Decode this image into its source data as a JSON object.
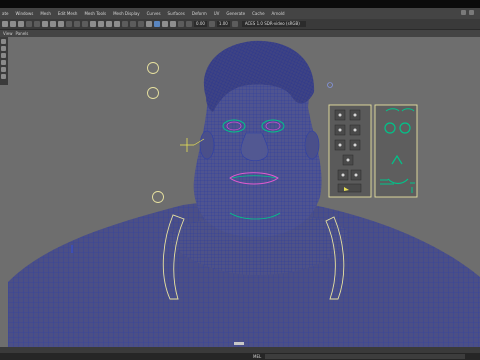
{
  "menubar": {
    "items": [
      "ate",
      "Windows",
      "Mesh",
      "Edit Mesh",
      "Mesh Tools",
      "Mesh Display",
      "Curves",
      "Surfaces",
      "Deform",
      "UV",
      "Generate",
      "Cache",
      "Arnold"
    ]
  },
  "statusline": {
    "value_1": "0.00",
    "value_2": "1.00",
    "camera_dropdown": "ACES 1.0 SDR-video (sRGB)"
  },
  "panel_menu": {
    "items": [
      "View",
      "Panels"
    ]
  },
  "command_line": {
    "label": "MEL"
  },
  "colors": {
    "viewport_bg": "#6e6e6e",
    "wireframe": "#2d3fa8",
    "mesh_fill": "#4e5288",
    "face_rig": "#00c48a",
    "control_curve": "#e8e2a0",
    "selection": "#e8e055"
  }
}
